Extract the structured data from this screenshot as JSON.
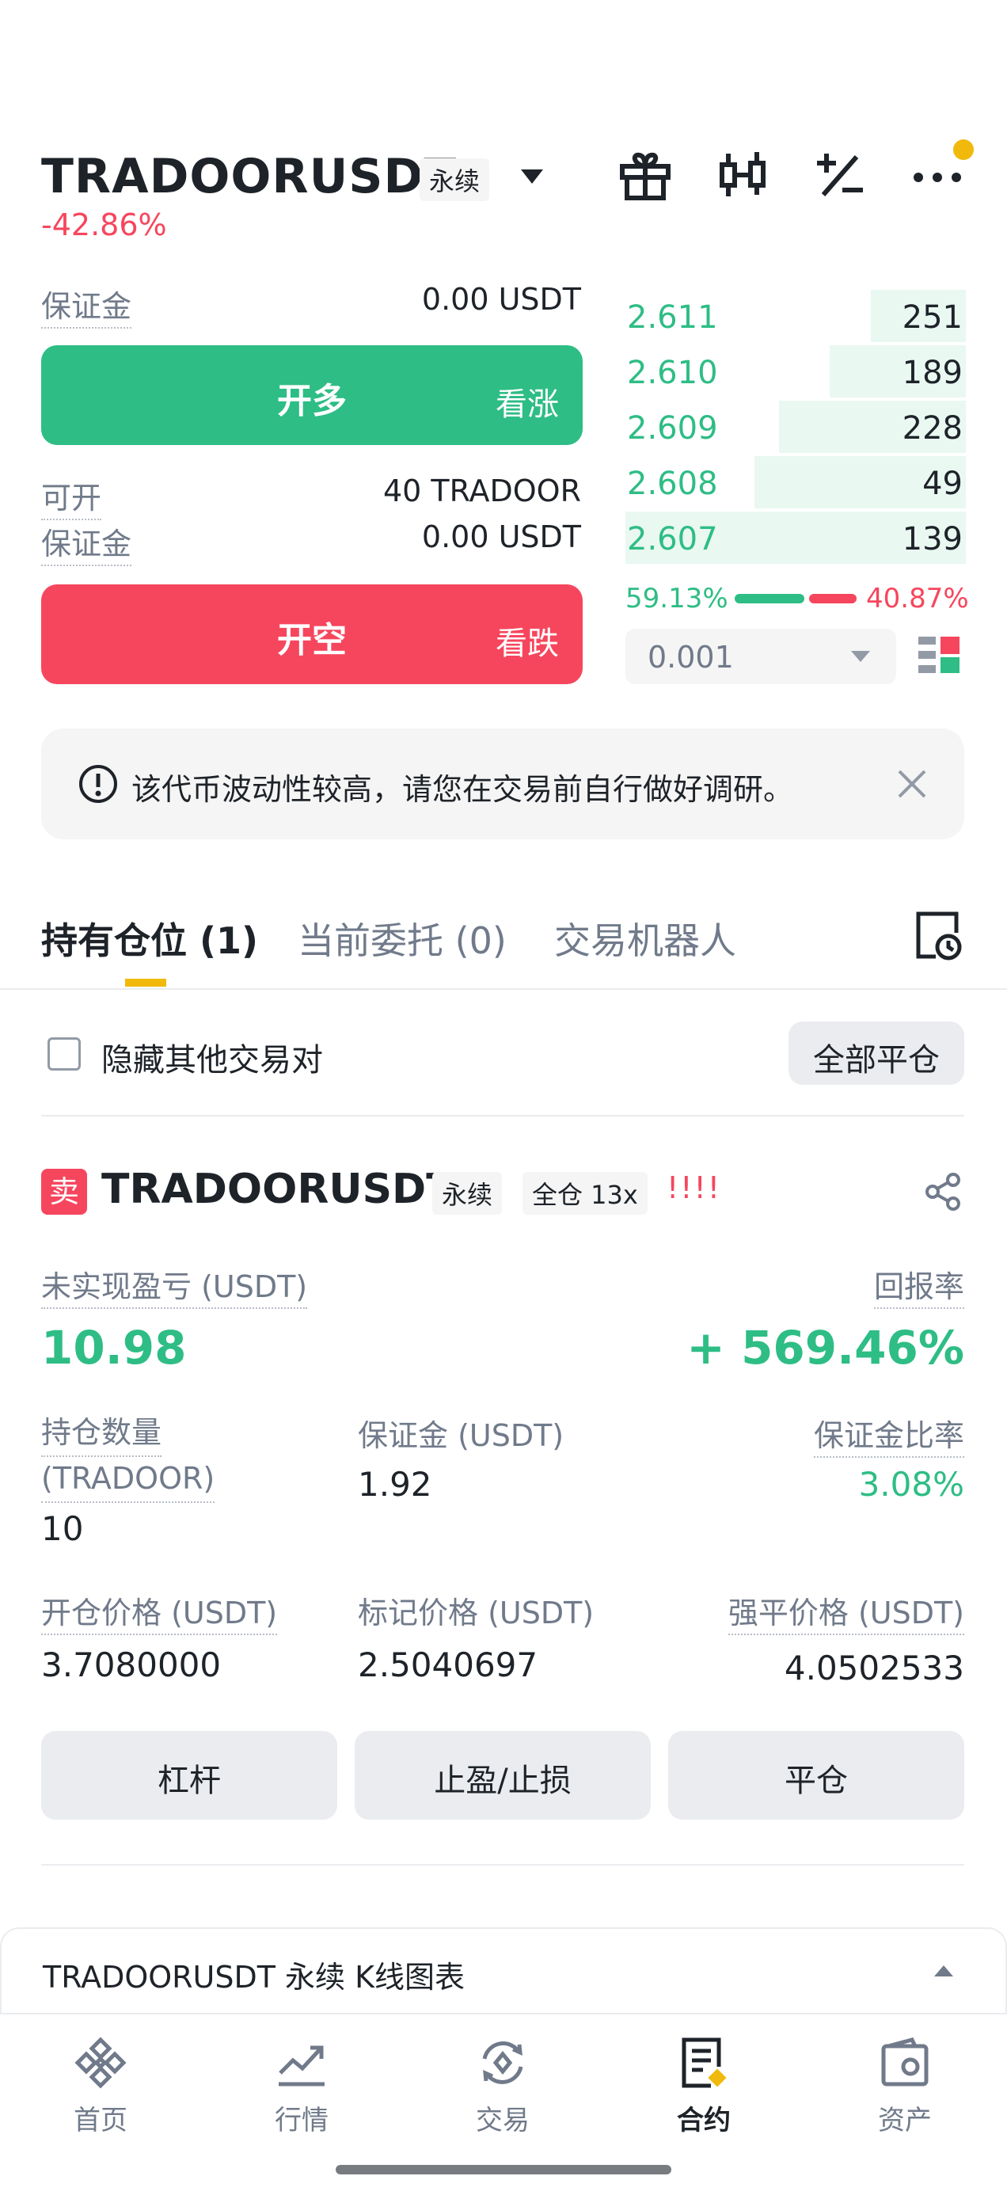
{
  "header": {
    "symbol": "TRADOORUSDT",
    "contract_type": "永续",
    "change_pct": "-42.86%",
    "icons": [
      "caret-down-icon",
      "gift-icon",
      "candlestick-icon",
      "plus-minus-icon",
      "more-icon"
    ]
  },
  "long_panel": {
    "margin_label": "保证金",
    "margin_value": "0.00 USDT",
    "open_long_label": "开多",
    "open_long_sub": "看涨"
  },
  "short_panel": {
    "available_label": "可开",
    "available_value": "40 TRADOOR",
    "margin_label": "保证金",
    "margin_value": "0.00 USDT",
    "open_short_label": "开空",
    "open_short_sub": "看跌"
  },
  "order_book": {
    "bids": [
      {
        "price": "2.611",
        "qty": "251",
        "depth": 0.28
      },
      {
        "price": "2.610",
        "qty": "189",
        "depth": 0.4
      },
      {
        "price": "2.609",
        "qty": "228",
        "depth": 0.55
      },
      {
        "price": "2.608",
        "qty": "49",
        "depth": 0.62
      },
      {
        "price": "2.607",
        "qty": "139",
        "depth": 1.0
      }
    ],
    "buy_ratio": "59.13%",
    "sell_ratio": "40.87%",
    "buy_ratio_value": 59.13,
    "precision": "0.001"
  },
  "notice": {
    "text": "该代币波动性较高，请您在交易前自行做好调研。"
  },
  "tabs": [
    {
      "label": "持有仓位 (1)",
      "active": true
    },
    {
      "label": "当前委托 (0)",
      "active": false
    },
    {
      "label": "交易机器人",
      "active": false
    }
  ],
  "filter": {
    "hide_others_label": "隐藏其他交易对",
    "close_all_label": "全部平仓"
  },
  "position": {
    "side_badge": "卖",
    "symbol": "TRADOORUSDT",
    "contract_type": "永续",
    "margin_mode": "全仓 13x",
    "risk_bars": "!!!!",
    "unrealized_pnl_label": "未实现盈亏 (USDT)",
    "unrealized_pnl_value": "10.98",
    "roe_label": "回报率",
    "roe_value": "+ 569.46%",
    "size_label": "持仓数量",
    "size_unit": "(TRADOOR)",
    "size_value": "10",
    "margin_label": "保证金 (USDT)",
    "margin_value": "1.92",
    "margin_ratio_label": "保证金比率",
    "margin_ratio_value": "3.08%",
    "entry_price_label": "开仓价格 (USDT)",
    "entry_price_value": "3.7080000",
    "mark_price_label": "标记价格 (USDT)",
    "mark_price_value": "2.5040697",
    "liq_price_label": "强平价格 (USDT)",
    "liq_price_value": "4.0502533",
    "buttons": {
      "leverage": "杠杆",
      "tp_sl": "止盈/止损",
      "close": "平仓"
    }
  },
  "kline_bar": {
    "label": "TRADOORUSDT 永续 K线图表"
  },
  "bottom_nav": [
    {
      "label": "首页",
      "icon": "home-icon",
      "active": false
    },
    {
      "label": "行情",
      "icon": "markets-icon",
      "active": false
    },
    {
      "label": "交易",
      "icon": "trade-icon",
      "active": false
    },
    {
      "label": "合约",
      "icon": "futures-icon",
      "active": true
    },
    {
      "label": "资产",
      "icon": "wallet-icon",
      "active": false
    }
  ],
  "colors": {
    "green": "#2ebd85",
    "red": "#f6465d",
    "accent_yellow": "#f0b90b",
    "text": "#1e2329",
    "muted": "#707a8a"
  }
}
